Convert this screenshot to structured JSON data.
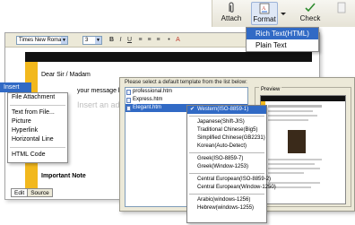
{
  "toolbar": {
    "attach_label": "Attach",
    "format_label": "Format",
    "check_label": "Check"
  },
  "format_menu": {
    "items": [
      {
        "label": "Rich Text(HTML)",
        "selected": true
      },
      {
        "label": "Plain Text",
        "selected": false
      }
    ]
  },
  "editor": {
    "font_name": "Times New Roman",
    "font_size": "3",
    "greeting": "Dear Sir / Madam",
    "message_placeholder": "your message here>",
    "advert_text": "Insert an advertiseme",
    "important_note": "Important Note",
    "tabs": [
      "Edit",
      "Source"
    ],
    "active_tab": "Edit"
  },
  "insert_menu": {
    "title": "Insert",
    "items": [
      "File Attachment",
      "Text from File...",
      "Picture",
      "Hyperlink",
      "Horizontal Line",
      "HTML Code"
    ]
  },
  "template_dialog": {
    "caption": "Please select a default template from the list below:",
    "files": [
      {
        "name": "professional.htm",
        "selected": false
      },
      {
        "name": "Express.htm",
        "selected": false
      },
      {
        "name": "Elegant.htm",
        "selected": true
      }
    ],
    "preview_label": "Preview"
  },
  "encoding_menu": {
    "selected": "Western(ISO-8859-1)",
    "groups": [
      [
        "Western(ISO-8859-1)"
      ],
      [
        "Japanese(Shift-JIS)",
        "Traditional Chinese(Big5)",
        "Simplified Chinese(GB2231)",
        "Korean(Auto-Detect)"
      ],
      [
        "Greek(ISO-8859-7)",
        "Greek(Window-1253)"
      ],
      [
        "Central European(ISO-8859-2)",
        "Central European(Window-1250)"
      ],
      [
        "Arabic(windows-1256)",
        "Hebrew(windows-1255)"
      ]
    ]
  },
  "colors": {
    "selection": "#316ac5",
    "accent_yellow": "#f2b81d",
    "chrome": "#ece9d8"
  }
}
